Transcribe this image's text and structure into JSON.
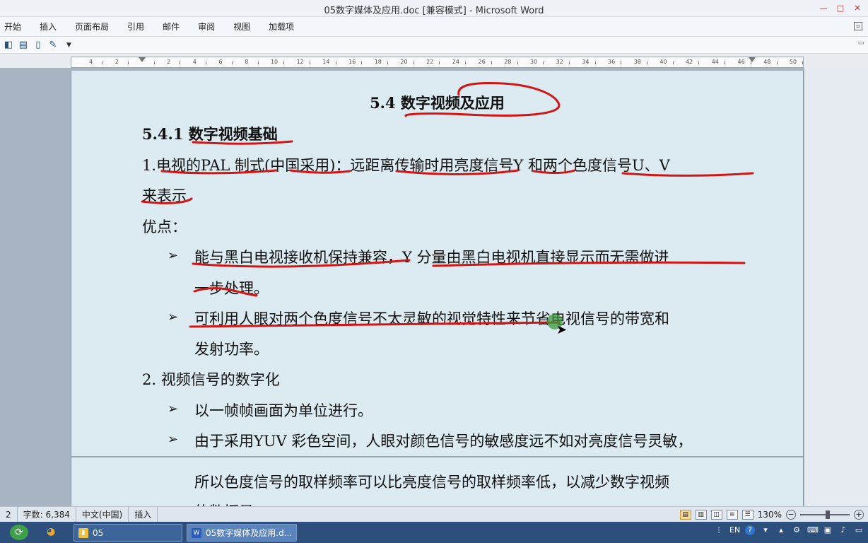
{
  "window": {
    "title": "05数字媒体及应用.doc [兼容模式] - Microsoft Word",
    "buttons": {
      "minimize": "—",
      "maximize": "□",
      "close": "✕"
    }
  },
  "ribbon": {
    "tabs": [
      "开始",
      "插入",
      "页面布局",
      "引用",
      "邮件",
      "审阅",
      "视图",
      "加载项"
    ]
  },
  "ruler": {
    "labels": [
      "4",
      "2",
      "",
      "2",
      "4",
      "6",
      "8",
      "10",
      "12",
      "14",
      "16",
      "18",
      "20",
      "22",
      "24",
      "26",
      "28",
      "30",
      "32",
      "34",
      "36",
      "38",
      "40",
      "42",
      "44",
      "46",
      "48",
      "50"
    ]
  },
  "document": {
    "heading1": "5.4  数字视频及应用",
    "heading2_num": "5.4.1",
    "heading2_text": "数字视频基础",
    "para1_line1": "1.电视的PAL 制式(中国采用)：远距离传输时用亮度信号Y  和两个色度信号U、V",
    "para1_line2": "来表示",
    "advantages": "优点：",
    "bullet_symbol": "➢",
    "bullet1_line1": "能与黑白电视接收机保持兼容，Y  分量由黑白电视机直接显示而无需做进",
    "bullet1_line2": "一步处理。",
    "bullet2_line1": "可利用人眼对两个色度信号不太灵敏的视觉特性来节省电视信号的带宽和",
    "bullet2_line2": "发射功率。",
    "para2": "2.  视频信号的数字化",
    "bullet3": "以一帧帧画面为单位进行。",
    "bullet4_line1": "由于采用YUV 彩色空间，人眼对颜色信号的敏感度远不如对亮度信号灵敏，",
    "bullet4_line2": "所以色度信号的取样频率可以比亮度信号的取样频率低，以减少数字视频",
    "bullet4_line3": "的数据量。"
  },
  "status_bar": {
    "page": "2",
    "word_count": "字数: 6,384",
    "language": "中文(中国)",
    "mode": "插入",
    "zoom": "130%",
    "zoom_out": "−",
    "zoom_in": "+"
  },
  "taskbar": {
    "tasks": [
      {
        "label": "05",
        "icon": "folder-icon"
      },
      {
        "label": "05数字媒体及应用.d...",
        "icon": "word-icon"
      }
    ],
    "tray_lang": "EN",
    "tray_help": "?"
  },
  "colors": {
    "page_bg": "#dcebf2",
    "annotation_ink": "#d21616",
    "cursor_highlight": "#3c9a3c",
    "taskbar": "#2c4f7c"
  }
}
